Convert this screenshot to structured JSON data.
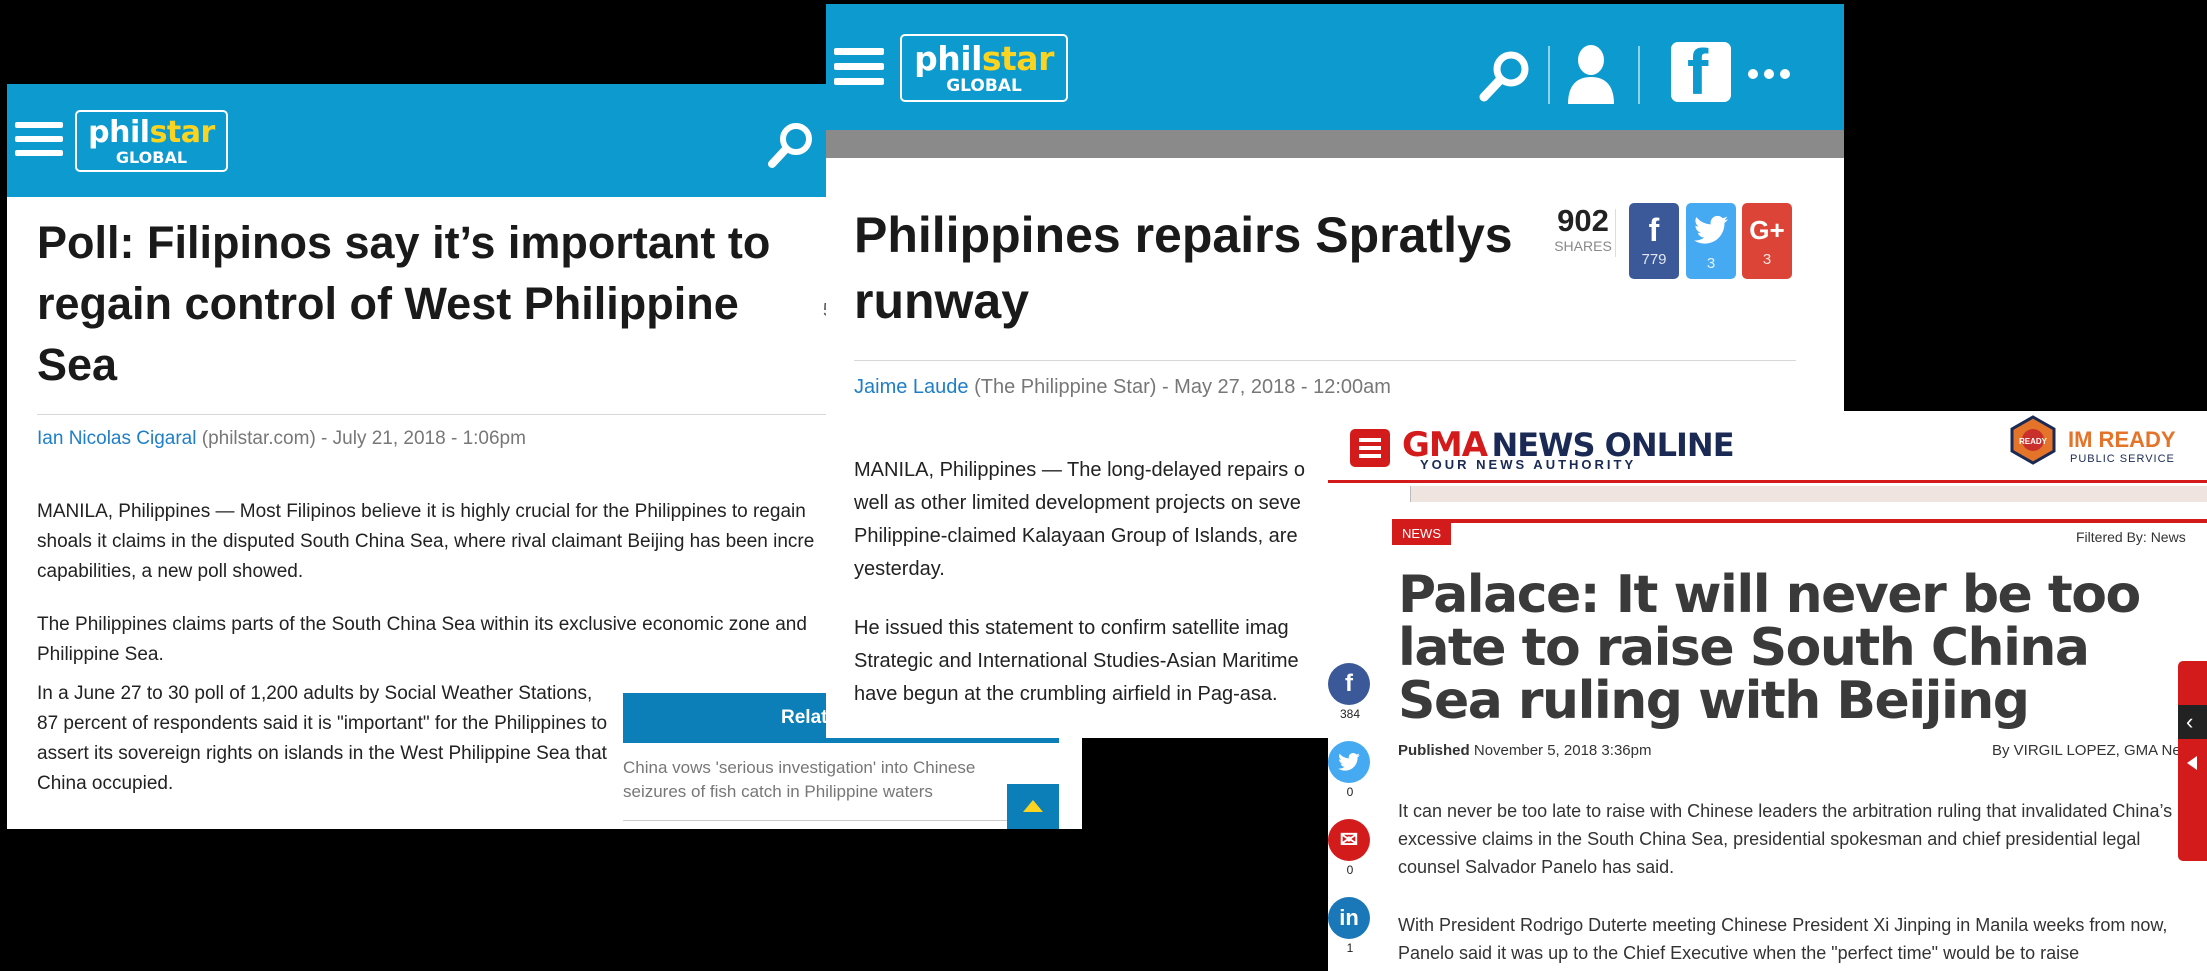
{
  "panel_a": {
    "logo_top_a": "phil",
    "logo_top_b": "star",
    "logo_bottom": "GLOBAL",
    "edge_text": "5",
    "title": "Poll: Filipinos say it’s important to regain control of West Philippine Sea",
    "author": "Ian Nicolas Cigaral",
    "byline_rest": " (philstar.com) - July 21, 2018 - 1:06pm",
    "paragraphs": [
      "MANILA, Philippines — Most Filipinos believe it is highly crucial for the Philippines to regain",
      "shoals it claims in the disputed South China Sea, where rival claimant Beijing has been incre",
      "capabilities, a new poll showed.",
      "The Philippines claims parts of the South China Sea within its exclusive economic zone and",
      "Philippine Sea.",
      "In a June 27 to 30 poll of 1,200 adults by Social Weather Stations, 87 percent of respondents said it is \"important\" for the Philippines to assert its sovereign rights on islands in the West Philippine Sea that China occupied."
    ],
    "related_title": "Relate",
    "related_item": "China vows 'serious investigation' into Chinese seizures of fish catch in Philippine waters",
    "icons": {
      "menu": "hamburger-icon",
      "search": "search-icon",
      "up": "scroll-top-icon"
    },
    "colors": {
      "header": "#0d9acf",
      "star": "#fbd321",
      "link": "#1e7ec8"
    }
  },
  "panel_b": {
    "logo_top_a": "phil",
    "logo_top_b": "star",
    "logo_bottom": "GLOBAL",
    "title": "Philippines repairs Spratlys runway",
    "shares_count": "902",
    "shares_label": "SHARES",
    "share_buttons": [
      {
        "network": "facebook",
        "glyph": "f",
        "count": "779"
      },
      {
        "network": "twitter",
        "glyph": "t",
        "count": "3"
      },
      {
        "network": "google-plus",
        "glyph": "G+",
        "count": "3"
      }
    ],
    "author": "Jaime Laude",
    "byline_rest": " (The Philippine Star) - May 27, 2018 - 12:00am",
    "paragraphs": [
      "MANILA, Philippines — The long-delayed repairs o",
      "well as other limited development projects on seve",
      "Philippine-claimed Kalayaan Group of Islands, are",
      "yesterday.",
      "He issued this statement to confirm satellite imag",
      "Strategic and International Studies-Asian Maritime",
      "have begun at the crumbling airfield in Pag-asa."
    ],
    "header_fb_glyph": "f",
    "icons": {
      "menu": "hamburger-icon",
      "search": "search-icon",
      "user": "user-icon",
      "facebook": "facebook-icon",
      "more": "more-icon"
    }
  },
  "panel_c": {
    "logo_gma": "GMA",
    "logo_news": "NEWS ONLINE",
    "logo_tagline": "YOUR NEWS AUTHORITY",
    "imready": "IM READY",
    "imready_sub": "PUBLIC SERVICE",
    "imready_badge": "READY",
    "section_badge": "NEWS",
    "filtered_label": "Filtered By: News",
    "title": "Palace: It will never be too late to raise South China Sea ruling with Beijing",
    "published_label": "Published",
    "published_date": " November 5, 2018 3:36pm",
    "author": "By VIRGIL LOPEZ, GMA News",
    "paragraphs": [
      "It can never be too late to raise with Chinese leaders the arbitration ruling that invalidated China’s excessive claims in the South China Sea, presidential spokesman and chief presidential legal counsel Salvador Panelo has said.",
      "With President Rodrigo Duterte meeting Chinese President Xi Jinping in Manila weeks from now, Panelo said it was up to the Chief Executive when the \"perfect time\" would be to raise"
    ],
    "social": [
      {
        "network": "facebook",
        "glyph": "f",
        "count": "384"
      },
      {
        "network": "twitter",
        "glyph": "t",
        "count": "0"
      },
      {
        "network": "email",
        "glyph": "✉",
        "count": "0"
      },
      {
        "network": "linkedin",
        "glyph": "in",
        "count": "1"
      }
    ],
    "side_tab_glyph": "‹",
    "colors": {
      "brand_red": "#d41b1b",
      "navy": "#1a2a55",
      "orange": "#e3742a"
    }
  }
}
